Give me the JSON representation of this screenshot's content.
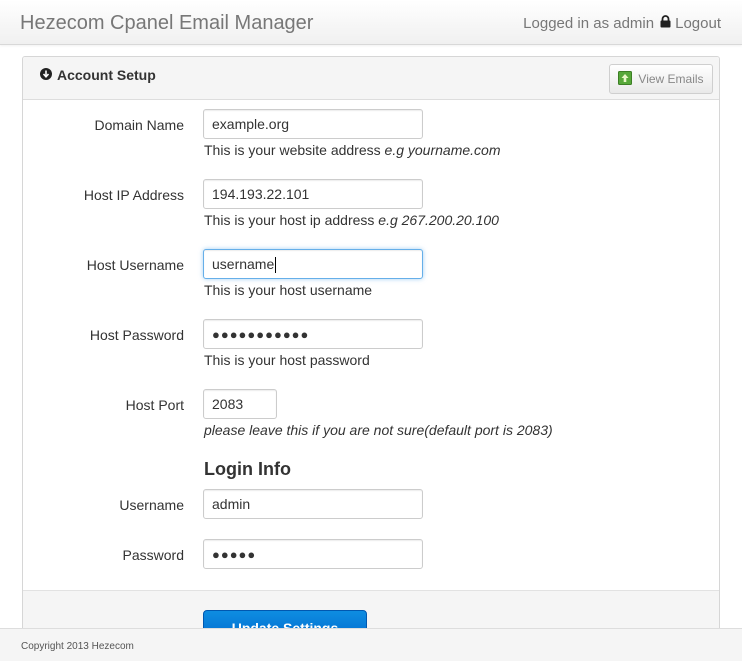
{
  "header": {
    "brand": "Hezecom Cpanel Email Manager",
    "logged_in_text": "Logged in as admin",
    "logout_label": "Logout",
    "lock_icon": "lock-icon"
  },
  "panel": {
    "title": "Account Setup",
    "title_icon": "circle-arrow-down-icon",
    "view_emails_label": "View Emails",
    "view_emails_icon": "green-up-arrow-icon"
  },
  "form": {
    "domain": {
      "label": "Domain Name",
      "value": "example.org",
      "help": "This is your website address",
      "help_example": "e.g yourname.com"
    },
    "host_ip": {
      "label": "Host IP Address",
      "value": "194.193.22.101",
      "help": "This is your host ip address",
      "help_example": "e.g 267.200.20.100"
    },
    "host_username": {
      "label": "Host Username",
      "value": "username",
      "help": "This is your host username"
    },
    "host_password": {
      "label": "Host Password",
      "value": "●●●●●●●●●●●",
      "help": "This is your host password"
    },
    "host_port": {
      "label": "Host Port",
      "value": "2083",
      "help": "please leave this if you are not sure(default port is 2083)"
    },
    "login_section_title": "Login Info",
    "username": {
      "label": "Username",
      "value": "admin"
    },
    "password": {
      "label": "Password",
      "value": "●●●●●"
    },
    "submit_label": "Update Settings"
  },
  "footer": {
    "copyright": "Copyright 2013 Hezecom"
  },
  "colors": {
    "accent": "#0a7bd6",
    "focus_border": "#66afe9",
    "icon_green": "#57a83a"
  }
}
